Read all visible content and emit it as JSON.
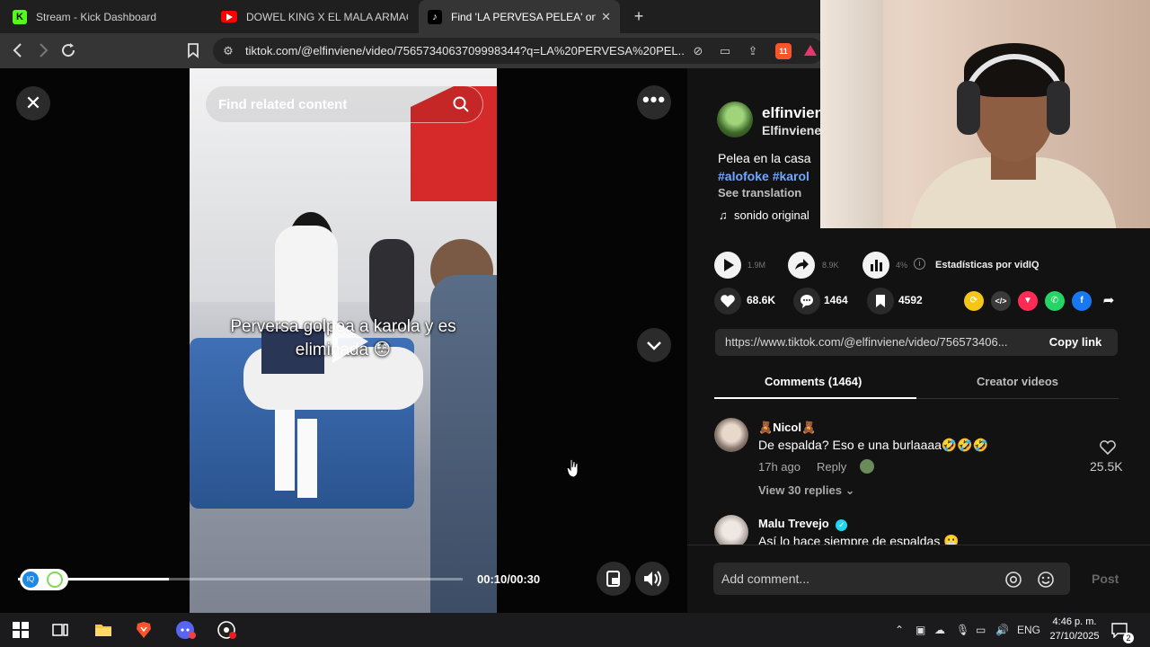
{
  "browser": {
    "tabs": [
      {
        "title": "Stream - Kick Dashboard",
        "favicon": "kick-icon",
        "active": false
      },
      {
        "title": "DOWEL KING X EL MALA ARMAGEDC",
        "favicon": "youtube-icon",
        "active": false
      },
      {
        "title": "Find 'LA PERVESA PELEA' on TikT",
        "favicon": "tiktok-icon",
        "active": true
      }
    ],
    "url": "tiktok.com/@elfinviene/video/7565734063709998344?q=LA%20PERVESA%20PEL...",
    "shield_badge": "11"
  },
  "video": {
    "search_placeholder": "Find related content",
    "caption": "Perversa golpea a karola y es eliminada 😳",
    "time": "00:10/00:30",
    "progress": 0.34
  },
  "panel": {
    "author": "elfinvien",
    "author_sub": "Elfinviene ·",
    "description": "Pelea en la casa",
    "hashtags": "#alofoke #karol",
    "see_translation": "See translation",
    "sound": "sonido original",
    "stats": {
      "plays": "1.9M",
      "shares": "8.9K",
      "percent": "4%",
      "label": "Estadísticas por vidIQ"
    },
    "actions": {
      "likes": "68.6K",
      "comments": "1464",
      "saves": "4592"
    },
    "link": "https://www.tiktok.com/@elfinviene/video/756573406...",
    "copy_link": "Copy link",
    "tabs": {
      "comments": "Comments (1464)",
      "creator": "Creator videos"
    },
    "comments": [
      {
        "name": "🧸Nicol🧸",
        "text": "De espalda? Eso e una burlaaaa🤣🤣🤣",
        "time": "17h ago",
        "reply": "Reply",
        "likes": "25.5K",
        "view_replies": "View 30 replies"
      },
      {
        "name": "Malu Trevejo",
        "text": "Así lo hace siempre de espaldas 😬"
      }
    ],
    "comment_placeholder": "Add comment...",
    "post": "Post"
  },
  "taskbar": {
    "language": "ENG",
    "time": "4:46 p. m.",
    "date": "27/10/2025",
    "notifications": "2"
  },
  "colors": {
    "tiktok_red": "#fe2c55",
    "hashtag_blue": "#6fa8ff",
    "panel_bg": "#121212"
  }
}
